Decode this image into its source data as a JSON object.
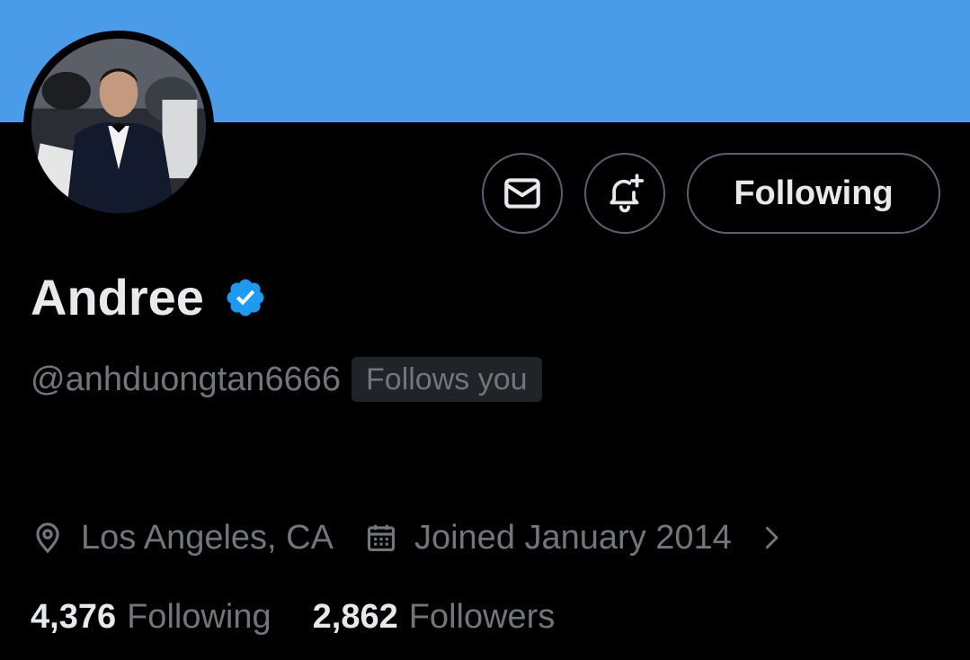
{
  "profile": {
    "display_name": "Andree",
    "handle": "@anhduongtan6666",
    "follows_you_badge": "Follows you",
    "verified": true,
    "avatar_alt": "profile photo"
  },
  "actions": {
    "message_icon": "envelope-icon",
    "notify_icon": "bell-plus-icon",
    "follow_label": "Following"
  },
  "meta": {
    "location": "Los Angeles, CA",
    "joined": "Joined January 2014",
    "location_icon": "location-pin-icon",
    "calendar_icon": "calendar-icon"
  },
  "stats": {
    "following_count": "4,376",
    "following_label": "Following",
    "followers_count": "2,862",
    "followers_label": "Followers"
  },
  "colors": {
    "banner": "#4a9be8",
    "background": "#000000",
    "primary_text": "#e7e9ea",
    "secondary_text": "#71767b",
    "verified_blue": "#1d9bf0",
    "border": "#536471"
  }
}
